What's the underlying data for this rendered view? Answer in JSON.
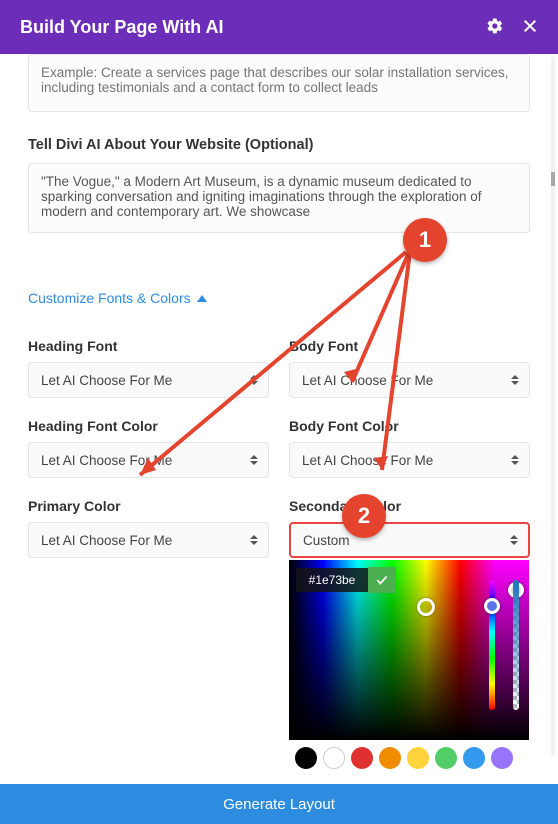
{
  "header": {
    "title": "Build Your Page With AI"
  },
  "prompt_example_placeholder": "Example: Create a services page that describes our solar installation services, including testimonials and a contact form to collect leads",
  "about_label": "Tell Divi AI About Your Website (Optional)",
  "about_value": "\"The Vogue,\" a Modern Art Museum, is a dynamic museum dedicated to sparking conversation and igniting imaginations through the exploration of modern and contemporary art. We showcase",
  "collapse_label": "Customize Fonts & Colors",
  "fields": {
    "heading_font": {
      "label": "Heading Font",
      "value": "Let AI Choose For Me"
    },
    "body_font": {
      "label": "Body Font",
      "value": "Let AI Choose For Me"
    },
    "heading_font_color": {
      "label": "Heading Font Color",
      "value": "Let AI Choose For Me"
    },
    "body_font_color": {
      "label": "Body Font Color",
      "value": "Let AI Choose For Me"
    },
    "primary_color": {
      "label": "Primary Color",
      "value": "Let AI Choose For Me"
    },
    "secondary_color": {
      "label": "Secondary Color",
      "value": "Custom"
    }
  },
  "picker": {
    "hex": "#1e73be",
    "swatches": [
      "#000000",
      "#ffffff",
      "#e03131",
      "#f08c00",
      "#ffd43b",
      "#51cf66",
      "#339af0",
      "#9775fa"
    ]
  },
  "footer_button": "Generate Layout",
  "annotations": {
    "step1": "1",
    "step2": "2"
  }
}
